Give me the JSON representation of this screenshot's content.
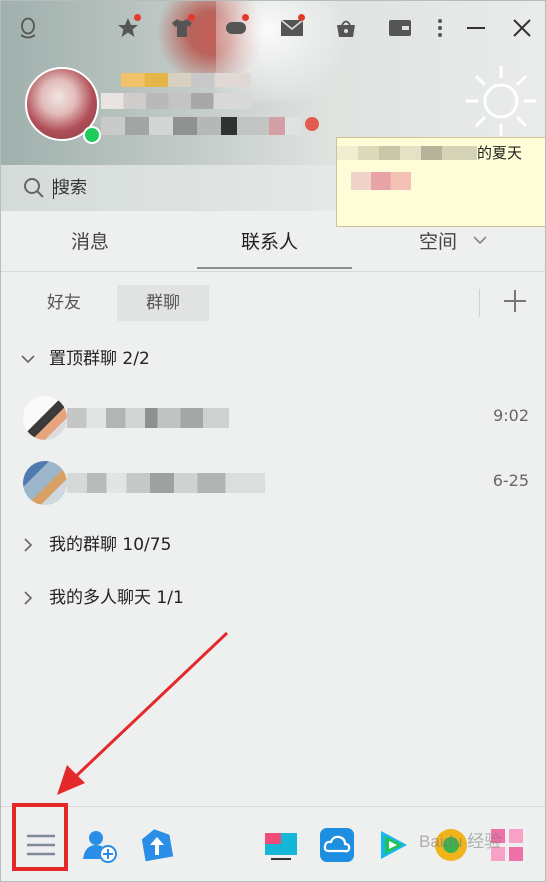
{
  "search": {
    "placeholder": "搜索"
  },
  "tabs": [
    {
      "label": "消息"
    },
    {
      "label": "联系人"
    },
    {
      "label": "空间"
    }
  ],
  "subtabs": [
    {
      "label": "好友"
    },
    {
      "label": "群聊"
    }
  ],
  "groups": [
    {
      "label": "置顶群聊 2/2",
      "expanded": true
    },
    {
      "label": "我的群聊 10/75",
      "expanded": false
    },
    {
      "label": "我的多人聊天 1/1",
      "expanded": false
    }
  ],
  "pinned_chats": [
    {
      "time": "9:02"
    },
    {
      "time": "6-25"
    }
  ],
  "tooltip": {
    "text_fragment": "的夏天"
  },
  "watermark": "Baidu 经验",
  "colors": {
    "online": "#1ecc5e",
    "highlight": "#e5282a",
    "badge": "#e23a2c"
  }
}
